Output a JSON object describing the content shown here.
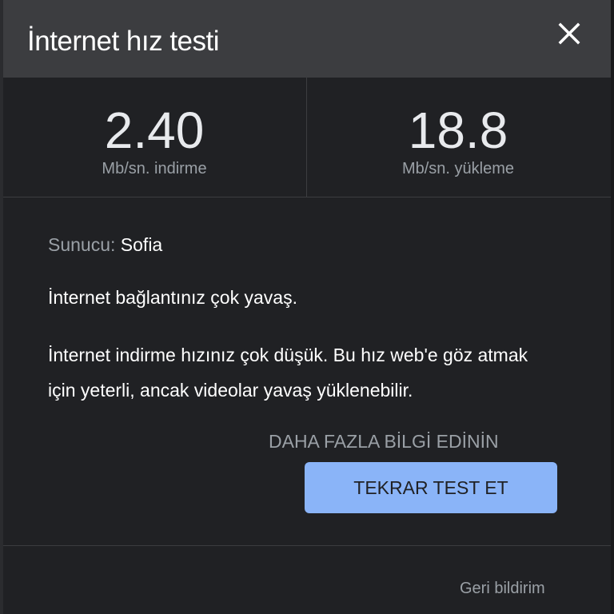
{
  "header": {
    "title": "İnternet hız testi",
    "close_icon": "close-icon"
  },
  "stats": {
    "download": {
      "value": "2.40",
      "unit": "Mb/sn. indirme"
    },
    "upload": {
      "value": "18.8",
      "unit": "Mb/sn. yükleme"
    }
  },
  "server": {
    "label": "Sunucu:",
    "value": "Sofia"
  },
  "status_text": "İnternet bağlantınız çok yavaş.",
  "description": "İnternet indirme hızınız çok düşük. Bu hız web'e göz atmak için yeterli, ancak videolar yavaş yüklenebilir.",
  "actions": {
    "learn_more": "DAHA FAZLA BİLGİ EDİNİN",
    "retest": "TEKRAR TEST ET"
  },
  "footer": {
    "feedback": "Geri bildirim"
  },
  "colors": {
    "background": "#202124",
    "header": "#3c3d40",
    "accent": "#8ab4f8",
    "muted_text": "#9aa0a6",
    "text": "#ffffff"
  }
}
